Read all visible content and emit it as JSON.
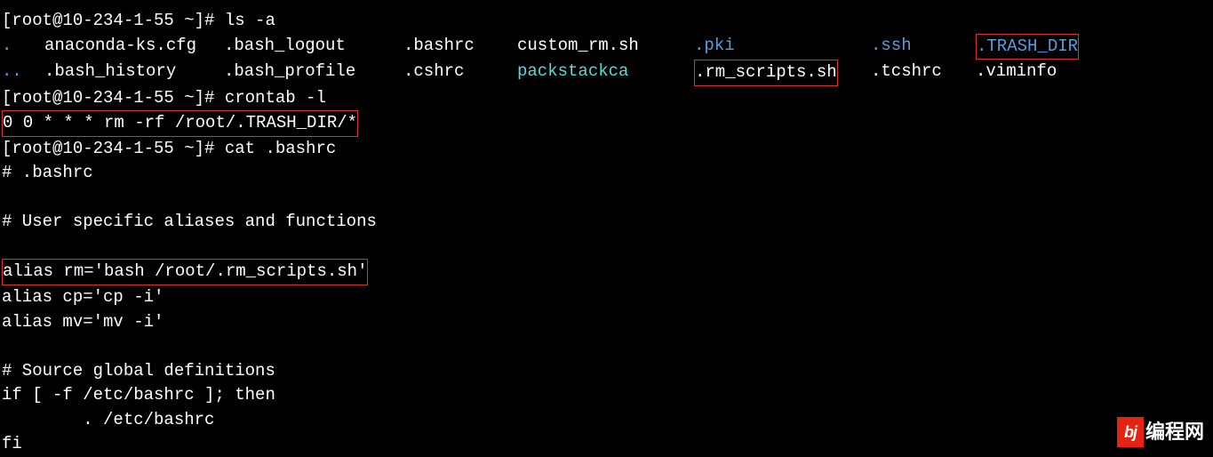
{
  "prompt": "[root@10-234-1-55 ~]# ",
  "cmd_ls": "ls -a",
  "cmd_crontab": "crontab -l",
  "cmd_cat": "cat .bashrc",
  "ls_output": {
    "row1": {
      "c0": ".",
      "c1": "anaconda-ks.cfg",
      "c2": ".bash_logout",
      "c3": ".bashrc",
      "c4": "custom_rm.sh",
      "c5": ".pki",
      "c6": ".ssh",
      "c7": ".TRASH_DIR"
    },
    "row2": {
      "c0": "..",
      "c1": ".bash_history",
      "c2": ".bash_profile",
      "c3": ".cshrc",
      "c4": "packstackca",
      "c5": ".rm_scripts.sh",
      "c6": ".tcshrc",
      "c7": ".viminfo"
    }
  },
  "crontab_output": "0 0 * * * rm -rf /root/.TRASH_DIR/*",
  "bashrc": {
    "l1": "# .bashrc",
    "l2": "",
    "l3": "# User specific aliases and functions",
    "l4": "",
    "l5": "alias rm='bash /root/.rm_scripts.sh'",
    "l6": "alias cp='cp -i'",
    "l7": "alias mv='mv -i'",
    "l8": "",
    "l9": "# Source global definitions",
    "l10": "if [ -f /etc/bashrc ]; then",
    "l11": "        . /etc/bashrc",
    "l12": "fi"
  },
  "watermark": {
    "badge": "bj",
    "text": "编程网"
  }
}
